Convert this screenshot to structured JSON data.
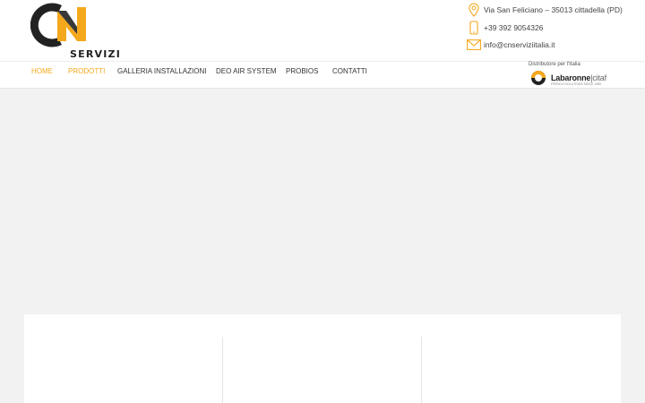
{
  "brand": {
    "logo_text": "SERVIZI",
    "colors": {
      "accent": "#f4a81c",
      "dark": "#222222"
    }
  },
  "contact": {
    "address": {
      "icon": "location-pin-icon",
      "text": "Via San Feliciano – 35013 cittadella (PD)"
    },
    "phone": {
      "icon": "mobile-phone-icon",
      "text": "+39 392 9054326"
    },
    "email": {
      "icon": "envelope-icon",
      "text": "info@cnserviziitalia.it"
    }
  },
  "nav": {
    "items": [
      {
        "label": "HOME",
        "active": true
      },
      {
        "label": "PRODOTTI",
        "active": true
      },
      {
        "label": "GALLERIA INSTALLAZIONI",
        "active": false
      },
      {
        "label": "DEO AIR SYSTEM",
        "active": false
      },
      {
        "label": "PROBIOS",
        "active": false
      },
      {
        "label": "CONTATTI",
        "active": false
      }
    ]
  },
  "distributor": {
    "label": "Distributore per l'Italia",
    "brand_main": "Labaronne",
    "brand_sep": "|",
    "brand_sub": "citaf",
    "tagline": "FRENCH SOLUTIONS SINCE 1980"
  }
}
